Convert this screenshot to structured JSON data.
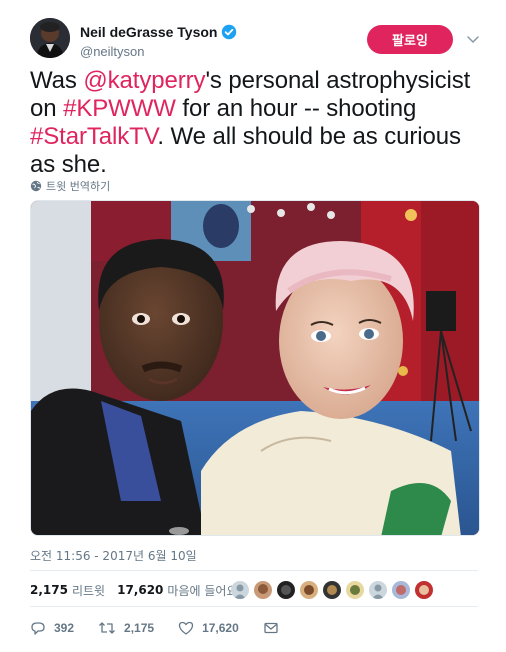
{
  "author": {
    "display_name": "Neil deGrasse Tyson",
    "handle": "@neiltyson",
    "verified_icon": "verified-badge-icon"
  },
  "follow_label": "팔로잉",
  "tweet": {
    "segments": [
      {
        "text": "Was ",
        "link": false
      },
      {
        "text": "@katyperry",
        "link": true
      },
      {
        "text": "'s personal astrophysicist on ",
        "link": false
      },
      {
        "text": "#KPWWW",
        "link": true
      },
      {
        "text": " for an hour -- shooting ",
        "link": false
      },
      {
        "text": "#StarTalkTV",
        "link": true
      },
      {
        "text": ". We all should be as curious as she.",
        "link": false
      }
    ]
  },
  "translate_label": "트윗 번역하기",
  "timestamp": "오전 11:56 - 2017년 6월 10일",
  "stats": {
    "retweets_count": "2,175",
    "retweets_label": "리트윗",
    "likes_count": "17,620",
    "likes_label": "마음에 들어요"
  },
  "actions": {
    "replies": "392",
    "retweets": "2,175",
    "likes": "17,620"
  },
  "colors": {
    "accent": "#e0245e",
    "verified": "#1da1f2",
    "muted": "#657786"
  }
}
